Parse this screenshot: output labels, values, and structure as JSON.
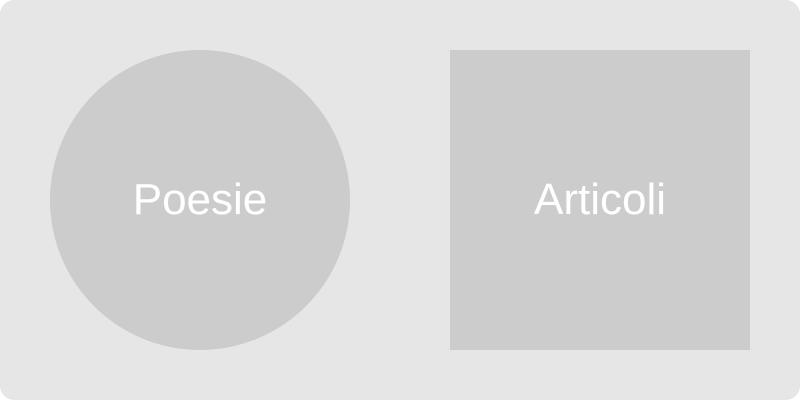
{
  "tiles": {
    "poesie": {
      "label": "Poesie",
      "shape": "circle"
    },
    "articoli": {
      "label": "Articoli",
      "shape": "square"
    }
  },
  "colors": {
    "panel_background": "#e6e6e6",
    "tile_background": "#cccccc",
    "label_text": "#ffffff"
  }
}
